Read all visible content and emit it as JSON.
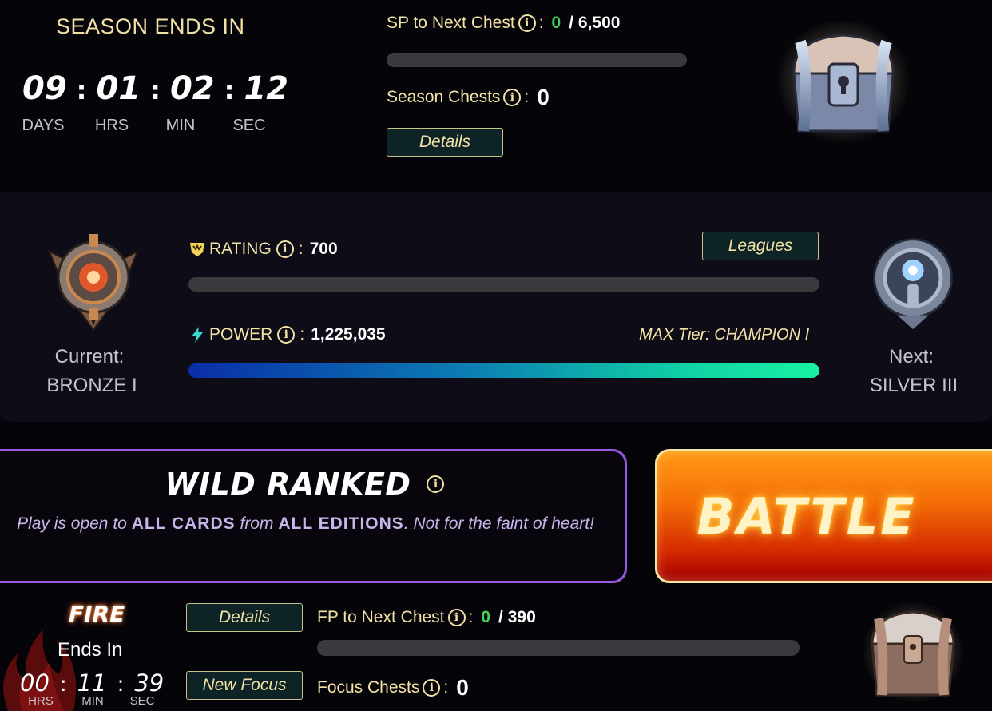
{
  "season": {
    "title": "SEASON ENDS IN",
    "timer": {
      "days": "09",
      "hrs": "01",
      "min": "02",
      "sec": "12"
    },
    "labels": {
      "days": "DAYS",
      "hrs": "HRS",
      "min": "MIN",
      "sec": "SEC"
    },
    "sp_label": "SP to Next Chest",
    "sp_current": "0",
    "sp_target": "/ 6,500",
    "sp_progress": 0,
    "chests_label": "Season Chests",
    "chests_count": "0",
    "details_label": "Details"
  },
  "league": {
    "rating_label": "RATING",
    "rating_value": "700",
    "rating_progress": 0,
    "power_label": "POWER",
    "power_value": "1,225,035",
    "power_progress": 1.0,
    "max_tier": "MAX Tier: CHAMPION I",
    "leagues_label": "Leagues",
    "current_label": "Current:",
    "current_rank": "BRONZE I",
    "next_label": "Next:",
    "next_rank": "SILVER III"
  },
  "mode": {
    "title": "WILD RANKED",
    "desc_1": "Play is open to",
    "desc_em1": "ALL CARDS",
    "desc_2": "from",
    "desc_em2": "ALL EDITIONS",
    "desc_3": ". Not for the faint of heart!",
    "battle_label": "BATTLE"
  },
  "focus": {
    "name": "FIRE",
    "ends_label": "Ends In",
    "timer": {
      "hrs": "00",
      "min": "11",
      "sec": "39"
    },
    "labels": {
      "hrs": "HRS",
      "min": "MIN",
      "sec": "SEC"
    },
    "details_label": "Details",
    "new_focus_label": "New Focus",
    "fp_label": "FP to Next Chest",
    "fp_current": "0",
    "fp_target": "/ 390",
    "fp_progress": 0,
    "chests_label": "Focus Chests",
    "chests_count": "0"
  },
  "colors": {
    "gold": "#f3e2a6",
    "green": "#46d25a",
    "purple_border": "#9a58e0",
    "battle_orange": "#f46d06",
    "power_gradient_end": "#18f2a2"
  }
}
